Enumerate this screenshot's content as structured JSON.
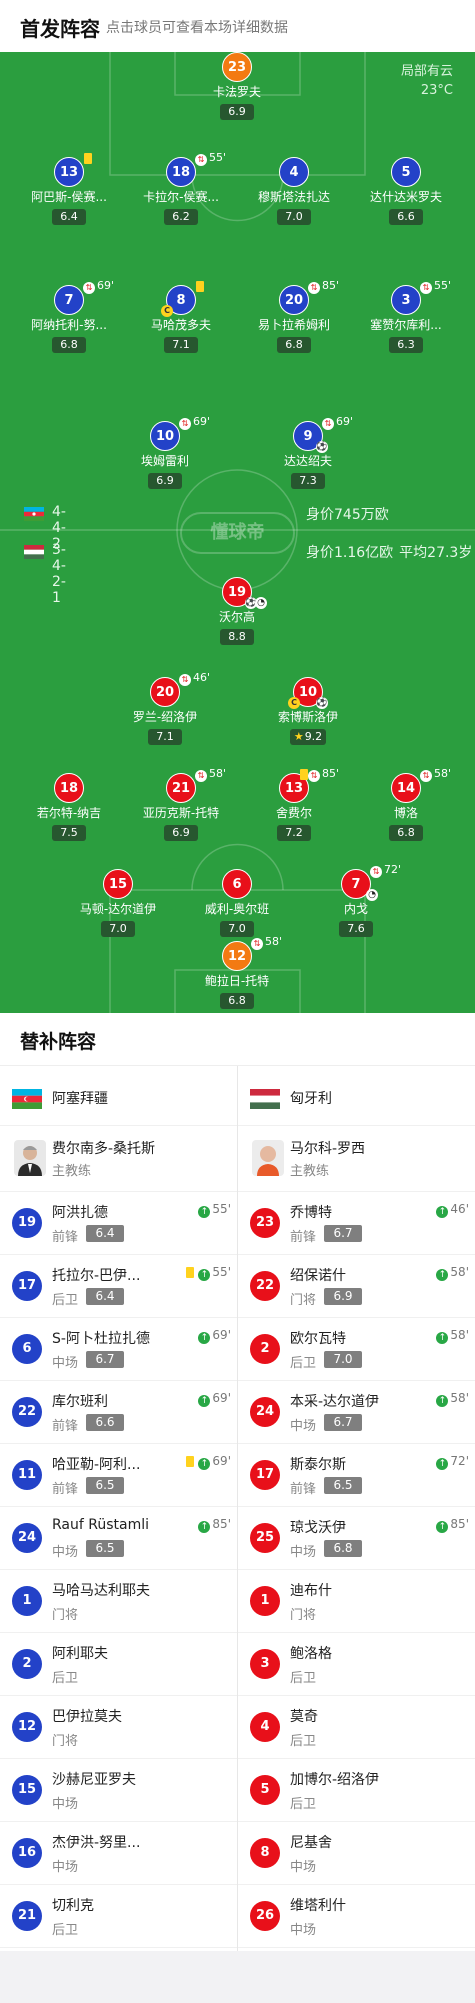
{
  "header": {
    "title": "首发阵容",
    "subtitle": "点击球员可查看本场详细数据"
  },
  "weather": {
    "condition": "局部有云",
    "temp": "23°C"
  },
  "logo_text": "懂球帝",
  "teams": {
    "azerbaijan": {
      "formation": "4-4-2",
      "value": "身价745万欧",
      "avg_age": ""
    },
    "hungary": {
      "formation": "3-4-2-1",
      "value": "身价1.16亿欧",
      "avg_age": "平均27.3岁"
    }
  },
  "home_players": [
    {
      "num": "23",
      "name": "卡法罗夫",
      "rating": "6.9",
      "color": "orange"
    },
    {
      "num": "13",
      "name": "阿巴斯-侯赛...",
      "rating": "6.4",
      "color": "blue"
    },
    {
      "num": "18",
      "name": "卡拉尔-侯赛...",
      "rating": "6.2",
      "color": "blue",
      "sub": "55'"
    },
    {
      "num": "4",
      "name": "穆斯塔法扎达",
      "rating": "7.0",
      "color": "blue"
    },
    {
      "num": "5",
      "name": "达什达米罗夫",
      "rating": "6.6",
      "color": "blue"
    },
    {
      "num": "7",
      "name": "阿纳托利-努...",
      "rating": "6.8",
      "color": "blue",
      "sub": "69'"
    },
    {
      "num": "8",
      "name": "马哈茂多夫",
      "rating": "7.1",
      "color": "blue"
    },
    {
      "num": "20",
      "name": "易卜拉希姆利",
      "rating": "6.8",
      "color": "blue",
      "sub": "85'"
    },
    {
      "num": "3",
      "name": "塞赞尔库利...",
      "rating": "6.3",
      "color": "blue",
      "sub": "55'"
    },
    {
      "num": "10",
      "name": "埃姆雷利",
      "rating": "6.9",
      "color": "blue",
      "sub": "69'"
    },
    {
      "num": "9",
      "name": "达达绍夫",
      "rating": "7.3",
      "color": "blue",
      "sub": "69'"
    }
  ],
  "away_players": [
    {
      "num": "19",
      "name": "沃尔高",
      "rating": "8.8",
      "color": "red"
    },
    {
      "num": "20",
      "name": "罗兰-绍洛伊",
      "rating": "7.1",
      "color": "red",
      "sub": "46'"
    },
    {
      "num": "10",
      "name": "索博斯洛伊",
      "rating": "9.2",
      "color": "red"
    },
    {
      "num": "18",
      "name": "若尔特-纳吉",
      "rating": "7.5",
      "color": "red"
    },
    {
      "num": "21",
      "name": "亚历克斯-托特",
      "rating": "6.9",
      "color": "red",
      "sub": "58'"
    },
    {
      "num": "13",
      "name": "舍费尔",
      "rating": "7.2",
      "color": "red",
      "sub": "85'"
    },
    {
      "num": "14",
      "name": "博洛",
      "rating": "6.8",
      "color": "red",
      "sub": "58'"
    },
    {
      "num": "15",
      "name": "马顿-达尔道伊",
      "rating": "7.0",
      "color": "red"
    },
    {
      "num": "6",
      "name": "威利-奥尔班",
      "rating": "7.0",
      "color": "red"
    },
    {
      "num": "7",
      "name": "内戈",
      "rating": "7.6",
      "color": "red",
      "sub": "72'"
    },
    {
      "num": "12",
      "name": "鲍拉日-托特",
      "rating": "6.8",
      "color": "orange",
      "sub": "58'"
    }
  ],
  "bench": {
    "title": "替补阵容",
    "left": {
      "team": "阿塞拜疆",
      "coach": {
        "name": "费尔南多-桑托斯",
        "role": "主教练"
      },
      "subs": [
        {
          "num": "19",
          "name": "阿洪扎德",
          "pos": "前锋",
          "rating": "6.4",
          "in": "55'"
        },
        {
          "num": "17",
          "name": "托拉尔-巴伊...",
          "pos": "后卫",
          "rating": "6.4",
          "in": "55'",
          "yellow": true
        },
        {
          "num": "6",
          "name": "S-阿卜杜拉扎德",
          "pos": "中场",
          "rating": "6.7",
          "in": "69'"
        },
        {
          "num": "22",
          "name": "库尔班利",
          "pos": "前锋",
          "rating": "6.6",
          "in": "69'"
        },
        {
          "num": "11",
          "name": "哈亚勒-阿利...",
          "pos": "前锋",
          "rating": "6.5",
          "in": "69'",
          "yellow": true
        },
        {
          "num": "24",
          "name": "Rauf Rüstamli",
          "pos": "中场",
          "rating": "6.5",
          "in": "85'"
        },
        {
          "num": "1",
          "name": "马哈马达利耶夫",
          "pos": "门将"
        },
        {
          "num": "2",
          "name": "阿利耶夫",
          "pos": "后卫"
        },
        {
          "num": "12",
          "name": "巴伊拉莫夫",
          "pos": "门将"
        },
        {
          "num": "15",
          "name": "沙赫尼亚罗夫",
          "pos": "中场"
        },
        {
          "num": "16",
          "name": "杰伊洪-努里...",
          "pos": "中场"
        },
        {
          "num": "21",
          "name": "切利克",
          "pos": "后卫"
        }
      ]
    },
    "right": {
      "team": "匈牙利",
      "coach": {
        "name": "马尔科-罗西",
        "role": "主教练"
      },
      "subs": [
        {
          "num": "23",
          "name": "乔博特",
          "pos": "前锋",
          "rating": "6.7",
          "in": "46'"
        },
        {
          "num": "22",
          "name": "绍保诺什",
          "pos": "门将",
          "rating": "6.9",
          "in": "58'"
        },
        {
          "num": "2",
          "name": "欧尔瓦特",
          "pos": "后卫",
          "rating": "7.0",
          "in": "58'"
        },
        {
          "num": "24",
          "name": "本采-达尔道伊",
          "pos": "中场",
          "rating": "6.7",
          "in": "58'"
        },
        {
          "num": "17",
          "name": "斯泰尔斯",
          "pos": "前锋",
          "rating": "6.5",
          "in": "72'"
        },
        {
          "num": "25",
          "name": "琼戈沃伊",
          "pos": "中场",
          "rating": "6.8",
          "in": "85'"
        },
        {
          "num": "1",
          "name": "迪布什",
          "pos": "门将"
        },
        {
          "num": "3",
          "name": "鲍洛格",
          "pos": "后卫"
        },
        {
          "num": "4",
          "name": "莫奇",
          "pos": "后卫"
        },
        {
          "num": "5",
          "name": "加博尔-绍洛伊",
          "pos": "后卫"
        },
        {
          "num": "8",
          "name": "尼基舍",
          "pos": "中场"
        },
        {
          "num": "26",
          "name": "维塔利什",
          "pos": "中场"
        }
      ]
    }
  },
  "colors": {
    "pitch": "#2b9e3f",
    "home": "#2342c8",
    "away": "#e8101a",
    "keeper": "#f37a12",
    "sub_in": "#28a745",
    "yellow": "#ffd21e"
  }
}
